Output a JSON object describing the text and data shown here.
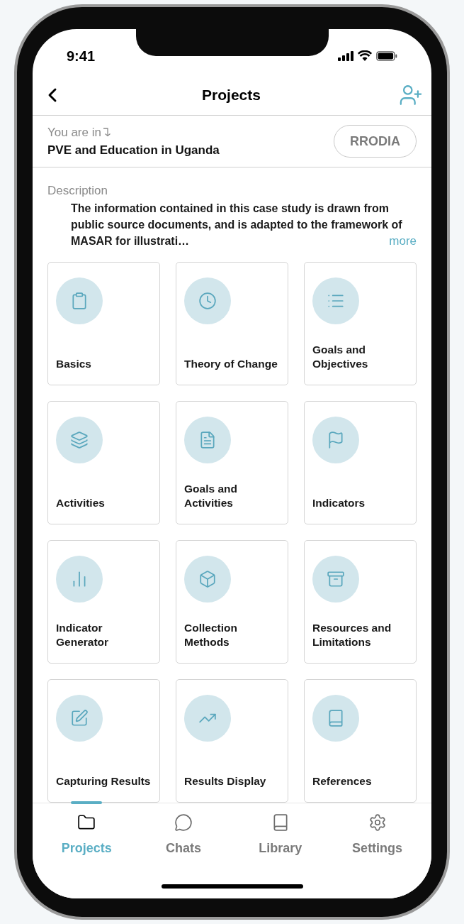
{
  "status_bar": {
    "time": "9:41"
  },
  "header": {
    "title": "Projects"
  },
  "context": {
    "label": "You are in",
    "project": "PVE and Education in Uganda",
    "badge": "RRODIA"
  },
  "description": {
    "label": "Description",
    "text": "The information contained in this case study is drawn from public source documents, and is adapted to the framework of MASAR for illustrati…",
    "more": "more"
  },
  "cards": [
    {
      "label": "Basics"
    },
    {
      "label": "Theory of Change"
    },
    {
      "label": "Goals and Objectives"
    },
    {
      "label": "Activities"
    },
    {
      "label": "Goals and Activities"
    },
    {
      "label": "Indicators"
    },
    {
      "label": "Indicator Generator"
    },
    {
      "label": "Collection Methods"
    },
    {
      "label": "Resources and Limitations"
    },
    {
      "label": "Capturing Results"
    },
    {
      "label": "Results Display"
    },
    {
      "label": "References"
    }
  ],
  "tabs": [
    {
      "label": "Projects",
      "selected": true
    },
    {
      "label": "Chats",
      "selected": false
    },
    {
      "label": "Library",
      "selected": false
    },
    {
      "label": "Settings",
      "selected": false
    }
  ]
}
